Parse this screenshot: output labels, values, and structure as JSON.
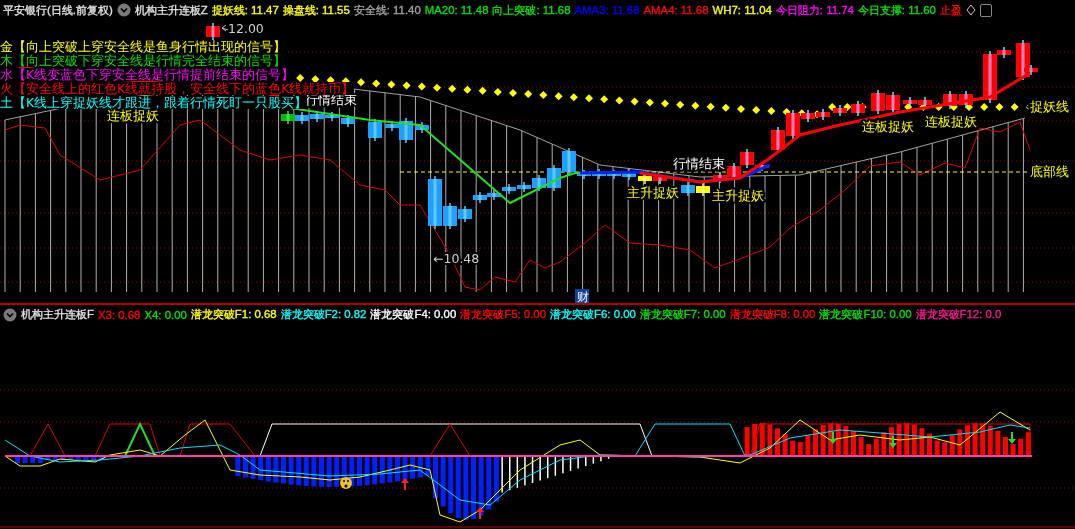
{
  "header": {
    "security": "平安银行(日线.前复权)",
    "indicator": "机构主升连板Z",
    "values": [
      {
        "text": "捉妖线: 11.47",
        "color": "#ffff00"
      },
      {
        "text": "操盘线: 11.55",
        "color": "#ffff00"
      },
      {
        "text": "安全线: 11.40",
        "color": "#a0a0a0"
      },
      {
        "text": "MA20: 11.48",
        "color": "#00e000"
      },
      {
        "text": "向上突破: 11.68",
        "color": "#00e000"
      },
      {
        "text": "AMA3: 11.68",
        "color": "#0000ff"
      },
      {
        "text": "AMA4: 11.68",
        "color": "#ff0000"
      },
      {
        "text": "WH7: 11.04",
        "color": "#ffff00"
      },
      {
        "text": "今日阻力: 11.74",
        "color": "#ff00ff"
      },
      {
        "text": "今日支撑: 11.60",
        "color": "#00e000"
      },
      {
        "text": "止盈",
        "color": "#ff0000"
      }
    ]
  },
  "legend": [
    {
      "text": "金【向上突破上穿安全线是鱼身行情出现的信号】",
      "color": "#ffff00"
    },
    {
      "text": "木【向上突破下穿安全线是行情完全结束的信号】",
      "color": "#00e000"
    },
    {
      "text": "水【K线变蓝色下穿安全线是行情提前结束的信号】",
      "color": "#ff00ff"
    },
    {
      "text": "火【安全线上的红色K线就持股，安全线下的蓝色K线就持币】",
      "color": "#ff0000"
    },
    {
      "text": "土【K线上穿捉妖线才跟进，跟着行情死盯一只股买】",
      "color": "#00ffff"
    }
  ],
  "chart_labels": [
    {
      "text": "12.00",
      "kind": "price"
    },
    {
      "text": "←10.48",
      "kind": "price"
    },
    {
      "text": "行情结束",
      "kind": "signal"
    },
    {
      "text": "行情结束",
      "kind": "signal"
    },
    {
      "text": "连板捉妖",
      "kind": "tag"
    },
    {
      "text": "主升捉妖",
      "kind": "tag"
    },
    {
      "text": "主升捉妖",
      "kind": "tag"
    },
    {
      "text": "连板捉妖",
      "kind": "tag"
    },
    {
      "text": "连板捉妖",
      "kind": "tag"
    },
    {
      "text": "捉妖线",
      "kind": "tag"
    },
    {
      "text": "底部线",
      "kind": "tag"
    },
    {
      "text": "财",
      "kind": "badge"
    }
  ],
  "sub_header": {
    "indicator": "机构主升连板F",
    "values": [
      {
        "text": "X3: 0.68",
        "color": "#ff0000"
      },
      {
        "text": "X4: 0.00",
        "color": "#00e000"
      },
      {
        "text": "潜龙突破F1: 0.68",
        "color": "#ffff00"
      },
      {
        "text": "潜龙突破F2: 0.82",
        "color": "#00ffff"
      },
      {
        "text": "潜龙突破F4: 0.00",
        "color": "#ffffff"
      },
      {
        "text": "潜龙突破F5: 0.00",
        "color": "#ff0000"
      },
      {
        "text": "潜龙突破F6: 0.00",
        "color": "#00ffff"
      },
      {
        "text": "潜龙突破F7: 0.00",
        "color": "#00e000"
      },
      {
        "text": "潜龙突破F8: 0.00",
        "color": "#ff0000"
      },
      {
        "text": "潜龙突破F10: 0.00",
        "color": "#00e000"
      },
      {
        "text": "潜龙突破F12: 0.0",
        "color": "#ff1493"
      }
    ]
  }
}
